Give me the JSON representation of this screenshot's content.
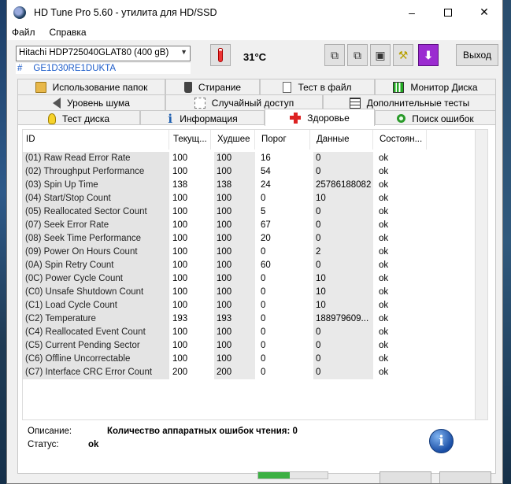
{
  "window": {
    "title": "HD Tune Pro 5.60 - утилита для HD/SSD"
  },
  "menu": [
    "Файл",
    "Справка"
  ],
  "drive": {
    "name": "Hitachi HDP725040GLAT80 (400 gB)",
    "serial_prefix": "#",
    "serial": "GE1D30RE1DUKTA",
    "temperature": "31°C"
  },
  "toolbar": {
    "exit_label": "Выход"
  },
  "tabs": {
    "row1": [
      "Использование папок",
      "Стирание",
      "Тест в файл",
      "Монитор Диска"
    ],
    "row2": [
      "Уровень шума",
      "Случайный доступ",
      "Дополнительные тесты"
    ],
    "row3": [
      "Тест диска",
      "Информация",
      "Здоровье",
      "Поиск ошибок"
    ],
    "active": "Здоровье"
  },
  "table": {
    "headers": [
      "ID",
      "Текущ...",
      "Худшее",
      "Порог",
      "Данные",
      "Состоян..."
    ],
    "rows": [
      [
        "(01) Raw Read Error Rate",
        "100",
        "100",
        "16",
        "0",
        "ok"
      ],
      [
        "(02) Throughput Performance",
        "100",
        "100",
        "54",
        "0",
        "ok"
      ],
      [
        "(03) Spin Up Time",
        "138",
        "138",
        "24",
        "25786188082",
        "ok"
      ],
      [
        "(04) Start/Stop Count",
        "100",
        "100",
        "0",
        "10",
        "ok"
      ],
      [
        "(05) Reallocated Sector Count",
        "100",
        "100",
        "5",
        "0",
        "ok"
      ],
      [
        "(07) Seek Error Rate",
        "100",
        "100",
        "67",
        "0",
        "ok"
      ],
      [
        "(08) Seek Time Performance",
        "100",
        "100",
        "20",
        "0",
        "ok"
      ],
      [
        "(09) Power On Hours Count",
        "100",
        "100",
        "0",
        "2",
        "ok"
      ],
      [
        "(0A) Spin Retry Count",
        "100",
        "100",
        "60",
        "0",
        "ok"
      ],
      [
        "(0C) Power Cycle Count",
        "100",
        "100",
        "0",
        "10",
        "ok"
      ],
      [
        "(C0) Unsafe Shutdown Count",
        "100",
        "100",
        "0",
        "10",
        "ok"
      ],
      [
        "(C1) Load Cycle Count",
        "100",
        "100",
        "0",
        "10",
        "ok"
      ],
      [
        "(C2) Temperature",
        "193",
        "193",
        "0",
        "188979609...",
        "ok"
      ],
      [
        "(C4) Reallocated Event Count",
        "100",
        "100",
        "0",
        "0",
        "ok"
      ],
      [
        "(C5) Current Pending Sector",
        "100",
        "100",
        "0",
        "0",
        "ok"
      ],
      [
        "(C6) Offline Uncorrectable",
        "100",
        "100",
        "0",
        "0",
        "ok"
      ],
      [
        "(C7) Interface CRC Error Count",
        "200",
        "200",
        "0",
        "0",
        "ok"
      ]
    ]
  },
  "details": {
    "desc_label": "Описание:",
    "desc_value": "Количество аппаратных ошибок чтения: 0",
    "status_label": "Статус:",
    "status_value": "ok"
  },
  "colors": {
    "accent": "#1d5cc9",
    "progress": "#3cb043",
    "down_button": "#9b2bd0"
  }
}
